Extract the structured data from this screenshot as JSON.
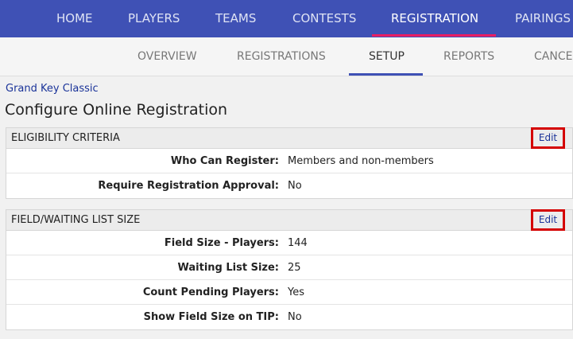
{
  "topnav": {
    "items": [
      {
        "label": "HOME"
      },
      {
        "label": "PLAYERS"
      },
      {
        "label": "TEAMS"
      },
      {
        "label": "CONTESTS"
      },
      {
        "label": "REGISTRATION"
      },
      {
        "label": "PAIRINGS"
      }
    ],
    "active": "REGISTRATION"
  },
  "subnav": {
    "items": [
      {
        "label": "OVERVIEW"
      },
      {
        "label": "REGISTRATIONS"
      },
      {
        "label": "SETUP"
      },
      {
        "label": "REPORTS"
      },
      {
        "label": "CANCEL"
      }
    ],
    "active": "SETUP"
  },
  "breadcrumb": "Grand Key Classic",
  "page_title": "Configure Online Registration",
  "sections": [
    {
      "title": "ELIGIBILITY CRITERIA",
      "edit_label": "Edit",
      "rows": [
        {
          "label": "Who Can Register:",
          "value": "Members and non-members"
        },
        {
          "label": "Require Registration Approval:",
          "value": "No"
        }
      ]
    },
    {
      "title": "FIELD/WAITING LIST SIZE",
      "edit_label": "Edit",
      "rows": [
        {
          "label": "Field Size - Players:",
          "value": "144"
        },
        {
          "label": "Waiting List Size:",
          "value": "25"
        },
        {
          "label": "Count Pending Players:",
          "value": "Yes"
        },
        {
          "label": "Show Field Size on TIP:",
          "value": "No"
        }
      ]
    }
  ],
  "colors": {
    "topnav_bg": "#3f51b5",
    "active_tab_underline": "#e91e63",
    "subnav_active_underline": "#3f51b5",
    "edit_highlight": "#d40000",
    "link": "#1a3399"
  }
}
